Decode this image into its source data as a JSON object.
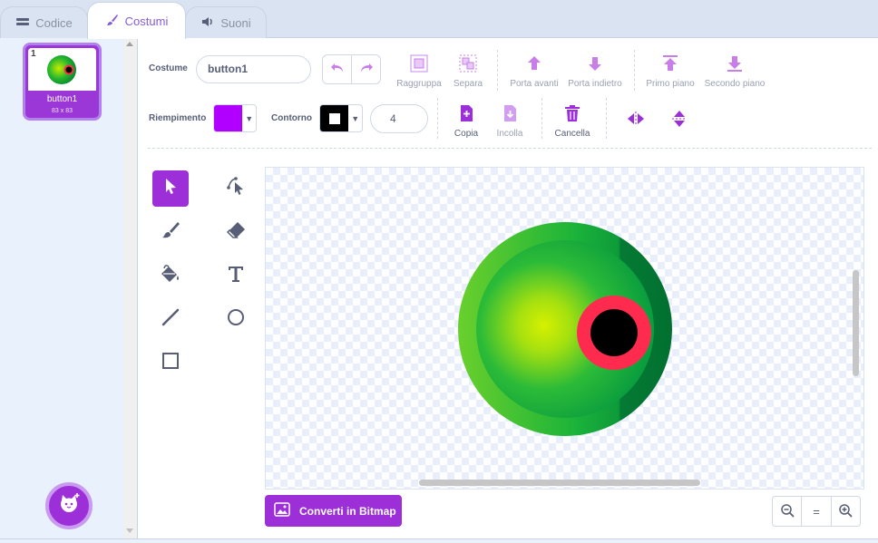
{
  "tabs": [
    {
      "label": "Codice",
      "icon": "code-icon"
    },
    {
      "label": "Costumi",
      "icon": "brush-icon"
    },
    {
      "label": "Suoni",
      "icon": "speaker-icon"
    }
  ],
  "costume_list": {
    "items": [
      {
        "number": "1",
        "name": "button1",
        "size": "83 x 83"
      }
    ]
  },
  "editor": {
    "costume_label": "Costume",
    "costume_name": "button1",
    "actions_row1": {
      "group": "Raggruppa",
      "ungroup": "Separa",
      "forward": "Porta avanti",
      "backward": "Porta indietro",
      "front": "Primo piano",
      "back": "Secondo piano"
    },
    "fill_label": "Riempimento",
    "fill_color": "#b100ff",
    "outline_label": "Contorno",
    "outline_color": "#000000",
    "outline_width": "4",
    "actions_row2": {
      "copy": "Copia",
      "paste": "Incolla",
      "delete": "Cancella"
    },
    "convert_button": "Converti in Bitmap",
    "zoom": {
      "zoom_out": "−",
      "reset": "=",
      "zoom_in": "+"
    }
  },
  "colors": {
    "accent": "#9d2fd9",
    "tab_active_text": "#855cd6"
  }
}
